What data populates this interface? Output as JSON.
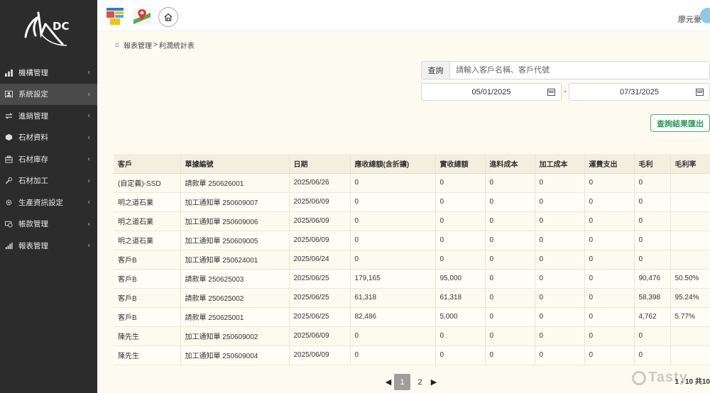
{
  "user": {
    "name": "廖元豪"
  },
  "breadcrumb": {
    "parent": "報表管理",
    "separator": ">",
    "current": "利潤統計表"
  },
  "sidebar": {
    "logo_text": "DC",
    "items": [
      {
        "label": "機構管理",
        "icon": "bar-chart-icon"
      },
      {
        "label": "系統設定",
        "icon": "user-card-icon"
      },
      {
        "label": "進銷管理",
        "icon": "exchange-icon"
      },
      {
        "label": "石材資料",
        "icon": "cube-icon"
      },
      {
        "label": "石材庫存",
        "icon": "warehouse-icon"
      },
      {
        "label": "石材加工",
        "icon": "tool-icon"
      },
      {
        "label": "生產資訊設定",
        "icon": "gear-icon"
      },
      {
        "label": "帳款管理",
        "icon": "money-icon"
      },
      {
        "label": "報表管理",
        "icon": "report-icon"
      }
    ],
    "active_index": 1
  },
  "search": {
    "label": "查詢",
    "placeholder": "請輸入客戶名稱、客戶代號"
  },
  "date_range": {
    "start": "05/01/2025",
    "separator": "-",
    "end": "07/31/2025"
  },
  "export_button": "查詢結果匯出",
  "table": {
    "headers": [
      "客戶",
      "單據編號",
      "日期",
      "應收總額(含折讓)",
      "實收總額",
      "進料成本",
      "加工成本",
      "運費支出",
      "毛利",
      "毛利率"
    ],
    "rows": [
      [
        "(自定義)-SSD",
        "請款單 250626001",
        "2025/06/26",
        "0",
        "0",
        "0",
        "0",
        "0",
        "0",
        ""
      ],
      [
        "明之道石業",
        "加工通知單 250609007",
        "2025/06/09",
        "0",
        "0",
        "0",
        "0",
        "0",
        "0",
        ""
      ],
      [
        "明之道石業",
        "加工通知單 250609006",
        "2025/06/09",
        "0",
        "0",
        "0",
        "0",
        "0",
        "0",
        ""
      ],
      [
        "明之道石業",
        "加工通知單 250609005",
        "2025/06/09",
        "0",
        "0",
        "0",
        "0",
        "0",
        "0",
        ""
      ],
      [
        "客戶B",
        "加工通知單 250624001",
        "2025/06/24",
        "0",
        "0",
        "0",
        "0",
        "0",
        "0",
        ""
      ],
      [
        "客戶B",
        "請款單 250625003",
        "2025/06/25",
        "179,165",
        "95,000",
        "0",
        "0",
        "0",
        "90,476",
        "50.50%"
      ],
      [
        "客戶B",
        "請款單 250625002",
        "2025/06/25",
        "61,318",
        "61,318",
        "0",
        "0",
        "0",
        "58,398",
        "95.24%"
      ],
      [
        "客戶B",
        "請款單 250625001",
        "2025/06/25",
        "82,486",
        "5,000",
        "0",
        "0",
        "0",
        "4,762",
        "5.77%"
      ],
      [
        "陳先生",
        "加工通知單 250609002",
        "2025/06/09",
        "0",
        "0",
        "0",
        "0",
        "0",
        "0",
        ""
      ],
      [
        "陳先生",
        "加工通知單 250609004",
        "2025/06/09",
        "0",
        "0",
        "0",
        "0",
        "0",
        "0",
        ""
      ]
    ]
  },
  "pagination": {
    "pages": [
      "1",
      "2"
    ],
    "current": "1",
    "info": "1 - 10 共10"
  },
  "watermark": "Tasty"
}
